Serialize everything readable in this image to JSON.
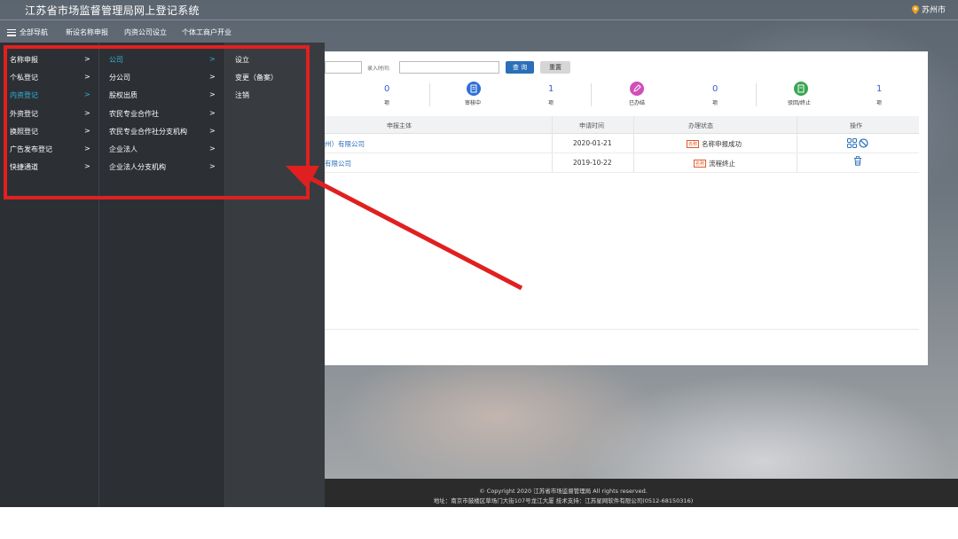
{
  "header": {
    "title": "江苏省市场监督管理局网上登记系统",
    "city": "苏州市"
  },
  "nav": {
    "all": "全部导航",
    "items": [
      "新设名称申报",
      "内资公司设立",
      "个体工商户开业"
    ]
  },
  "menu": {
    "col1": [
      {
        "label": "名称申报",
        "arrow": ">"
      },
      {
        "label": "个私登记",
        "arrow": ">"
      },
      {
        "label": "内资登记",
        "arrow": ">",
        "active": true
      },
      {
        "label": "外资登记",
        "arrow": ">"
      },
      {
        "label": "换照登记",
        "arrow": ">"
      },
      {
        "label": "广告发布登记",
        "arrow": ">"
      },
      {
        "label": "快捷通道",
        "arrow": ">"
      }
    ],
    "col2": [
      {
        "label": "公司",
        "arrow": ">",
        "active": true
      },
      {
        "label": "分公司",
        "arrow": ">"
      },
      {
        "label": "股权出质",
        "arrow": ">"
      },
      {
        "label": "农民专业合作社",
        "arrow": ">"
      },
      {
        "label": "农民专业合作社分支机构",
        "arrow": ">"
      },
      {
        "label": "企业法人",
        "arrow": ">"
      },
      {
        "label": "企业法人分支机构",
        "arrow": ">"
      }
    ],
    "col3": [
      {
        "label": "设立"
      },
      {
        "label": "变更（备案）"
      },
      {
        "label": "注销"
      }
    ]
  },
  "filters": {
    "time_label": "录入时间:",
    "query_button": "查 询",
    "reset_button": "重置"
  },
  "stats": [
    {
      "value": "0",
      "unit": "项",
      "label": ""
    },
    {
      "value": "",
      "unit": "",
      "label": "审核中"
    },
    {
      "value": "1",
      "unit": "项",
      "label": ""
    },
    {
      "value": "",
      "unit": "",
      "label": "已办结"
    },
    {
      "value": "0",
      "unit": "项",
      "label": ""
    },
    {
      "value": "",
      "unit": "",
      "label": "驳回/终止"
    },
    {
      "value": "1",
      "unit": "项",
      "label": ""
    }
  ],
  "table": {
    "headers": [
      "申报主体",
      "申请时间",
      "办理状态",
      "操作"
    ],
    "rows": [
      {
        "name": "州）有限公司",
        "date": "2020-01-21",
        "tag": "名称",
        "status": "名称申报成功"
      },
      {
        "name": "有限公司",
        "date": "2019-10-22",
        "tag": "名称",
        "status": "流程终止"
      }
    ]
  },
  "footer": {
    "line1": "© Copyright 2020 江苏省市场监督管理局 All rights reserved.",
    "line2": "地址：南京市鼓楼区草场门大街107号龙江大厦   技术支持：江苏星网软件有限公司(0512-68150316)"
  },
  "colors": {
    "menu_bg": "#2c3035",
    "active_text": "#2fb3d8",
    "annotation": "#e02020",
    "link": "#2b6fb8"
  },
  "icons": [
    "location-pin-icon",
    "menu-burger-icon",
    "review-icon",
    "done-icon",
    "reject-icon",
    "grid-icon",
    "ban-icon",
    "trash-icon"
  ]
}
